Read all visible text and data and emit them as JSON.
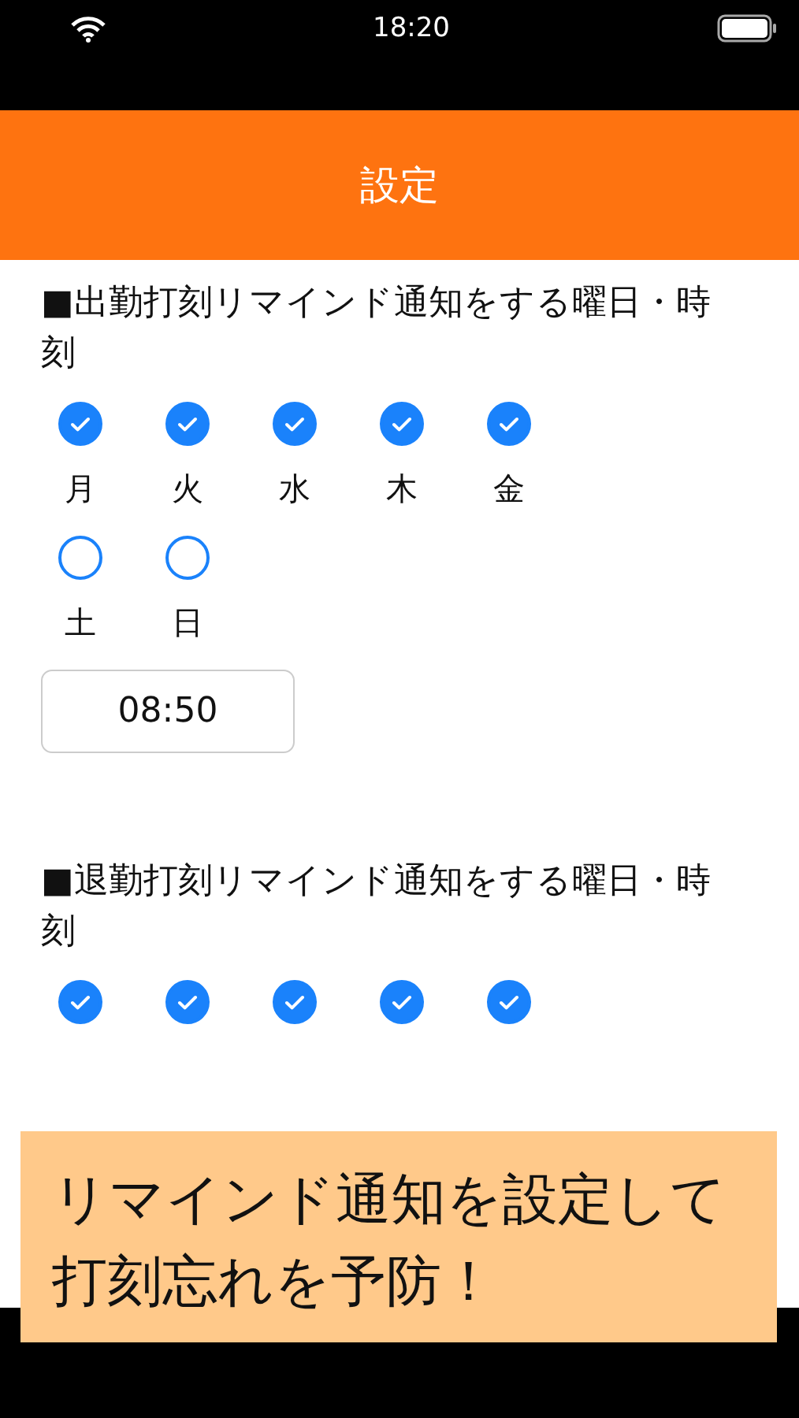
{
  "status_bar": {
    "time": "18:20"
  },
  "header": {
    "title": "設定"
  },
  "sections": [
    {
      "title": "■出勤打刻リマインド通知をする曜日・時刻",
      "days": [
        {
          "label": "月",
          "checked": true
        },
        {
          "label": "火",
          "checked": true
        },
        {
          "label": "水",
          "checked": true
        },
        {
          "label": "木",
          "checked": true
        },
        {
          "label": "金",
          "checked": true
        },
        {
          "label": "土",
          "checked": false
        },
        {
          "label": "日",
          "checked": false
        }
      ],
      "time": "08:50"
    },
    {
      "title": "■退勤打刻リマインド通知をする曜日・時刻",
      "days": [
        {
          "checked": true
        },
        {
          "checked": true
        },
        {
          "checked": true
        },
        {
          "checked": true
        },
        {
          "checked": true
        }
      ]
    }
  ],
  "banner": {
    "text": "リマインド通知を設定して打刻忘れを予防！"
  }
}
